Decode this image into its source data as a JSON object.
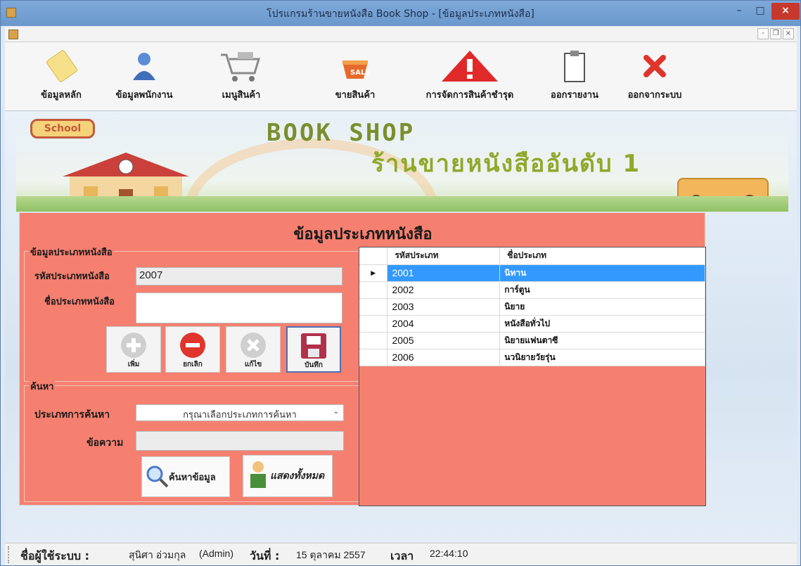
{
  "window": {
    "title": "โปรแกรมร้านขายหนังสือ Book Shop - [ข้อมูลประเภทหนังสือ]",
    "controls": {
      "minimize": "–",
      "maximize": "□",
      "close": "×"
    }
  },
  "mdi_controls": {
    "minimize": "-",
    "restore": "❐",
    "close": "×"
  },
  "toolbar": [
    {
      "label": "ข้อมูลหลัก",
      "icon": "notepad-icon"
    },
    {
      "label": "ข้อมูลพนักงาน",
      "icon": "user-icon"
    },
    {
      "label": "เมนูสินค้า",
      "icon": "cart-icon"
    },
    {
      "label": "ขายสินค้า",
      "icon": "basket-icon"
    },
    {
      "label": "การจัดการสินค้าชำรุด",
      "icon": "warning-icon"
    },
    {
      "label": "ออกรายงาน",
      "icon": "clipboard-icon"
    },
    {
      "label": "ออกจากระบบ",
      "icon": "exit-x-icon"
    }
  ],
  "banner": {
    "school_sign": "School",
    "line1": "BOOK SHOP",
    "line2": "ร้านขายหนังสืออันดับ 1"
  },
  "form": {
    "title": "ข้อมูลประเภทหนังสือ",
    "group_title": "ข้อมูลประเภทหนังสือ",
    "code_label": "รหัสประเภทหนังสือ",
    "code_value": "2007",
    "name_label": "ชื่อประเภทหนังสือ",
    "name_value": "",
    "buttons": {
      "add": "เพิ่ม",
      "cancel": "ยกเลิก",
      "edit": "แก้ไข",
      "save": "บันทึก"
    }
  },
  "search": {
    "group_title": "ค้นหา",
    "type_label": "ประเภทการค้นหา",
    "type_selected": "กรุณาเลือกประเภทการค้นหา",
    "text_label": "ข้อความ",
    "text_value": "",
    "search_button": "ค้นหาข้อมูล",
    "show_all_button": "แสดงทั้งหมด"
  },
  "grid": {
    "columns": [
      "รหัสประเภท",
      "ชื่อประเภท"
    ],
    "rows": [
      {
        "code": "2001",
        "name": "นิทาน",
        "selected": true
      },
      {
        "code": "2002",
        "name": "การ์ตูน"
      },
      {
        "code": "2003",
        "name": "นิยาย"
      },
      {
        "code": "2004",
        "name": "หนังสือทั่วไป"
      },
      {
        "code": "2005",
        "name": "นิยายแฟนตาซี"
      },
      {
        "code": "2006",
        "name": "นวนิยายวัยรุ่น"
      }
    ],
    "row_pointer": "▶"
  },
  "status": {
    "user_label": "ชื่อผู้ใช้ระบบ :",
    "user_value": "สุนิศา อ่วมกุล",
    "role": "(Admin)",
    "date_label": "วันที่ :",
    "date_value": "15 ตุลาคม 2557",
    "time_label": "เวลา",
    "time_value": "22:44:10"
  },
  "colors": {
    "panel": "#f58070",
    "selection": "#3399ff",
    "titlebar": "#7ea9d9"
  }
}
